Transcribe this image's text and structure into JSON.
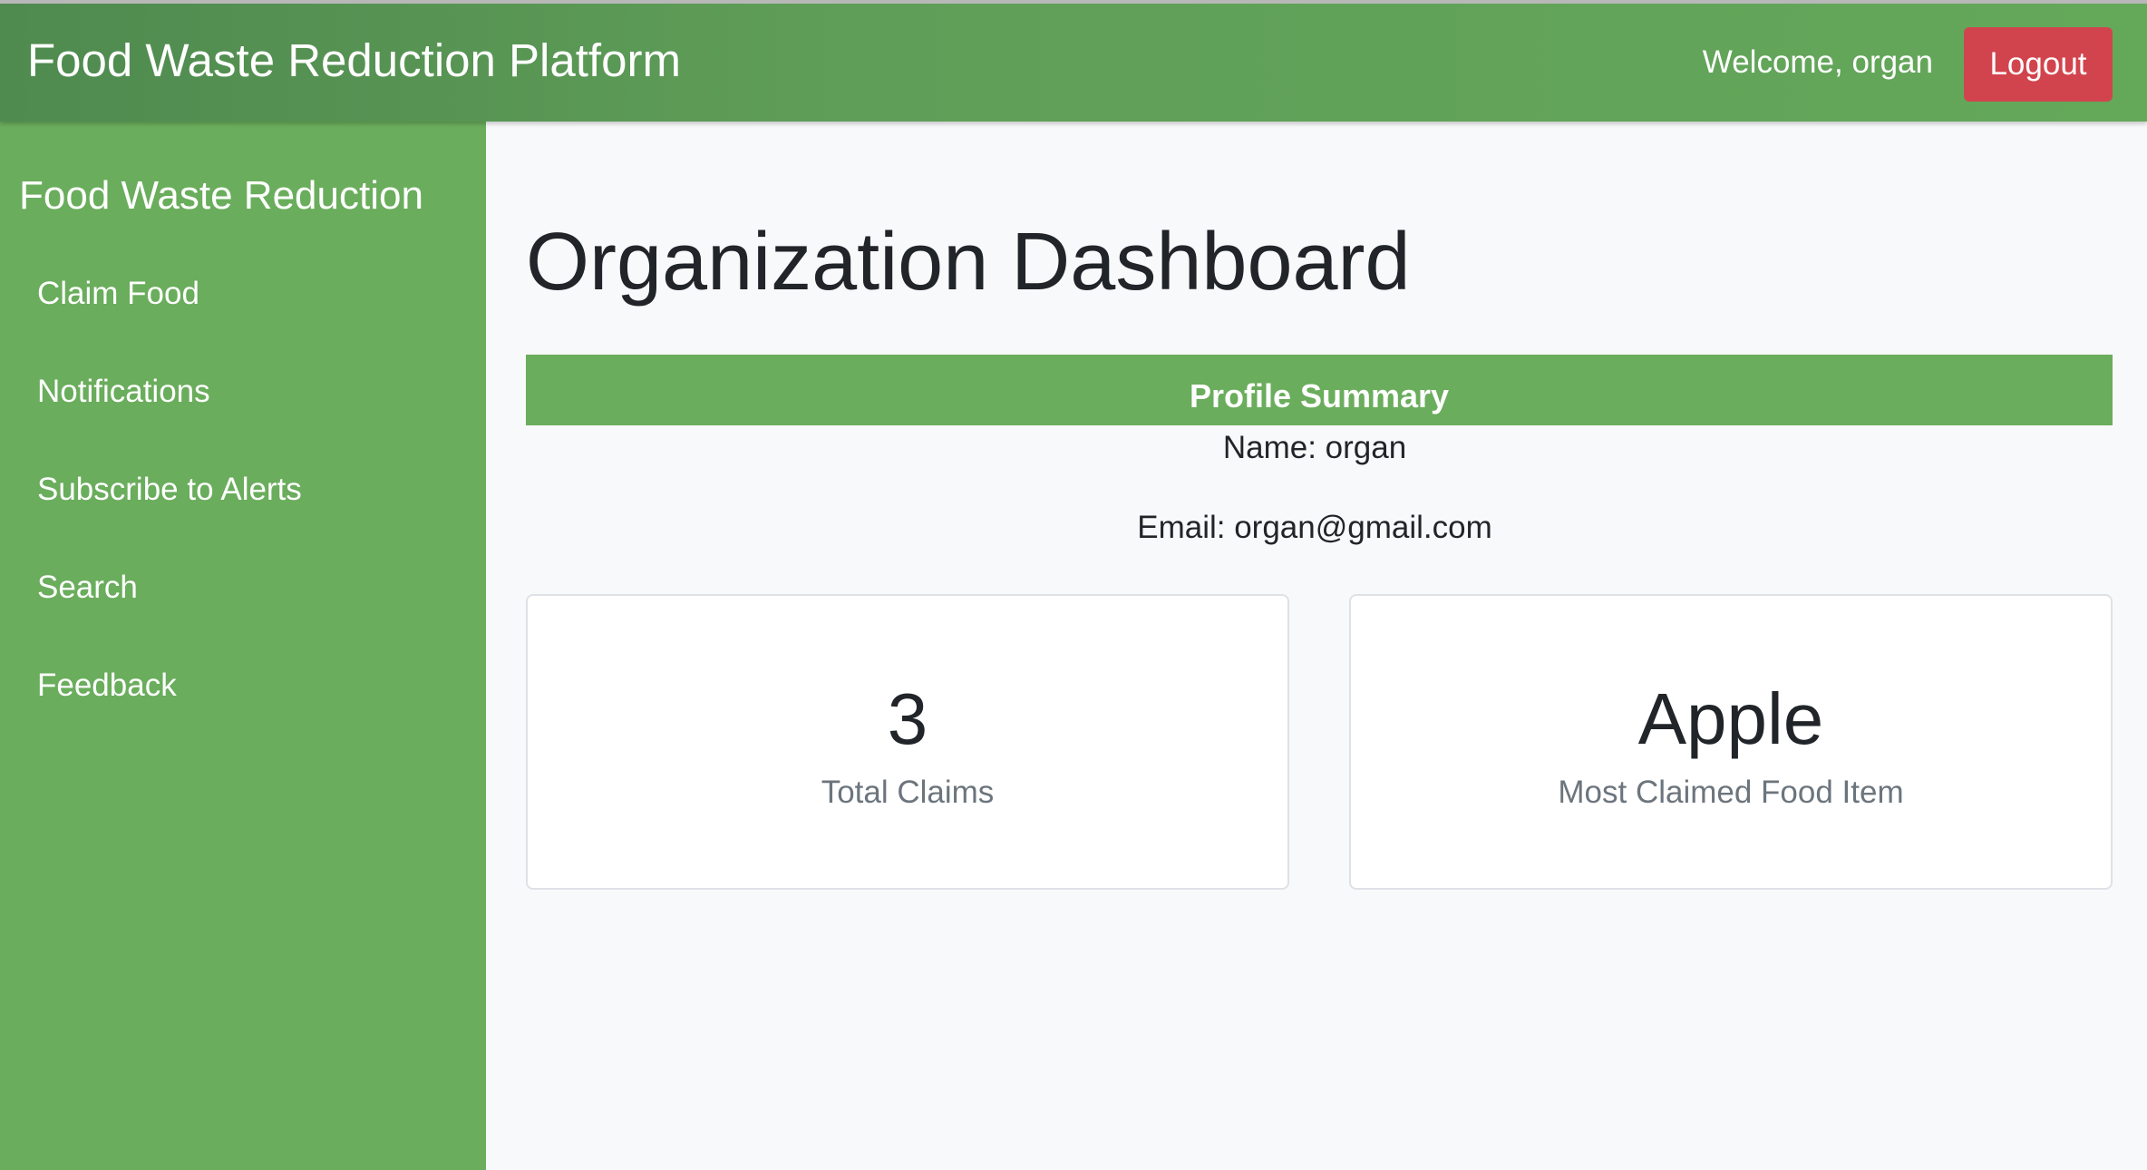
{
  "header": {
    "brand": "Food Waste Reduction Platform",
    "welcome": "Welcome, organ",
    "logout_label": "Logout"
  },
  "sidebar": {
    "title": "Food Waste Reduction",
    "items": [
      {
        "label": "Claim Food"
      },
      {
        "label": "Notifications"
      },
      {
        "label": "Subscribe to Alerts"
      },
      {
        "label": "Search"
      },
      {
        "label": "Feedback"
      }
    ]
  },
  "main": {
    "title": "Organization Dashboard",
    "profile": {
      "heading": "Profile Summary",
      "name": "Name: organ",
      "email": "Email: organ@gmail.com"
    },
    "stats": [
      {
        "value": "3",
        "label": "Total Claims"
      },
      {
        "value": "Apple",
        "label": "Most Claimed Food Item"
      }
    ]
  },
  "colors": {
    "header_green": "#5f9e58",
    "sidebar_green": "#6aad5c",
    "logout_red": "#d2444d",
    "background": "#f8f9fa",
    "text_dark": "#212529",
    "text_muted": "#6c757d"
  }
}
